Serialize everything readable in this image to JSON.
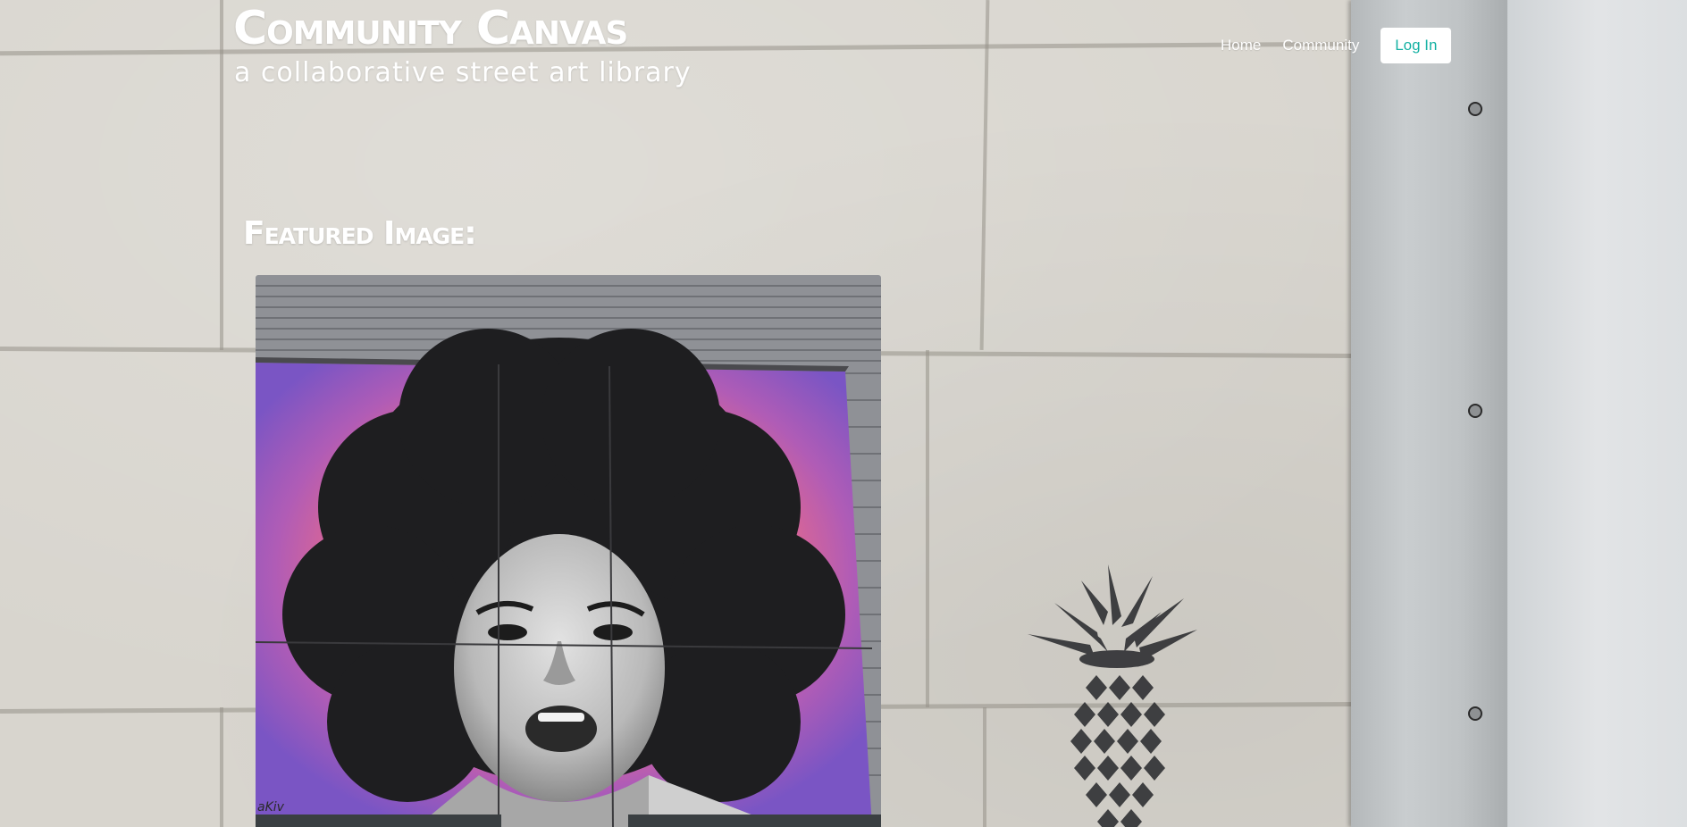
{
  "header": {
    "title": "Community Canvas",
    "tagline": "a collaborative street art library"
  },
  "nav": {
    "items": [
      {
        "label": "Home"
      },
      {
        "label": "Community"
      }
    ],
    "login_label": "Log In"
  },
  "featured": {
    "heading": "Featured Image:",
    "image_signature": "aKiv"
  },
  "colors": {
    "accent": "#17b2a4",
    "header_text": "#ffffff",
    "button_bg": "#ffffff"
  },
  "icons": {
    "bolts": [
      "bolt-icon",
      "bolt-icon",
      "bolt-icon"
    ],
    "background_stencil": "pineapple-stencil"
  }
}
